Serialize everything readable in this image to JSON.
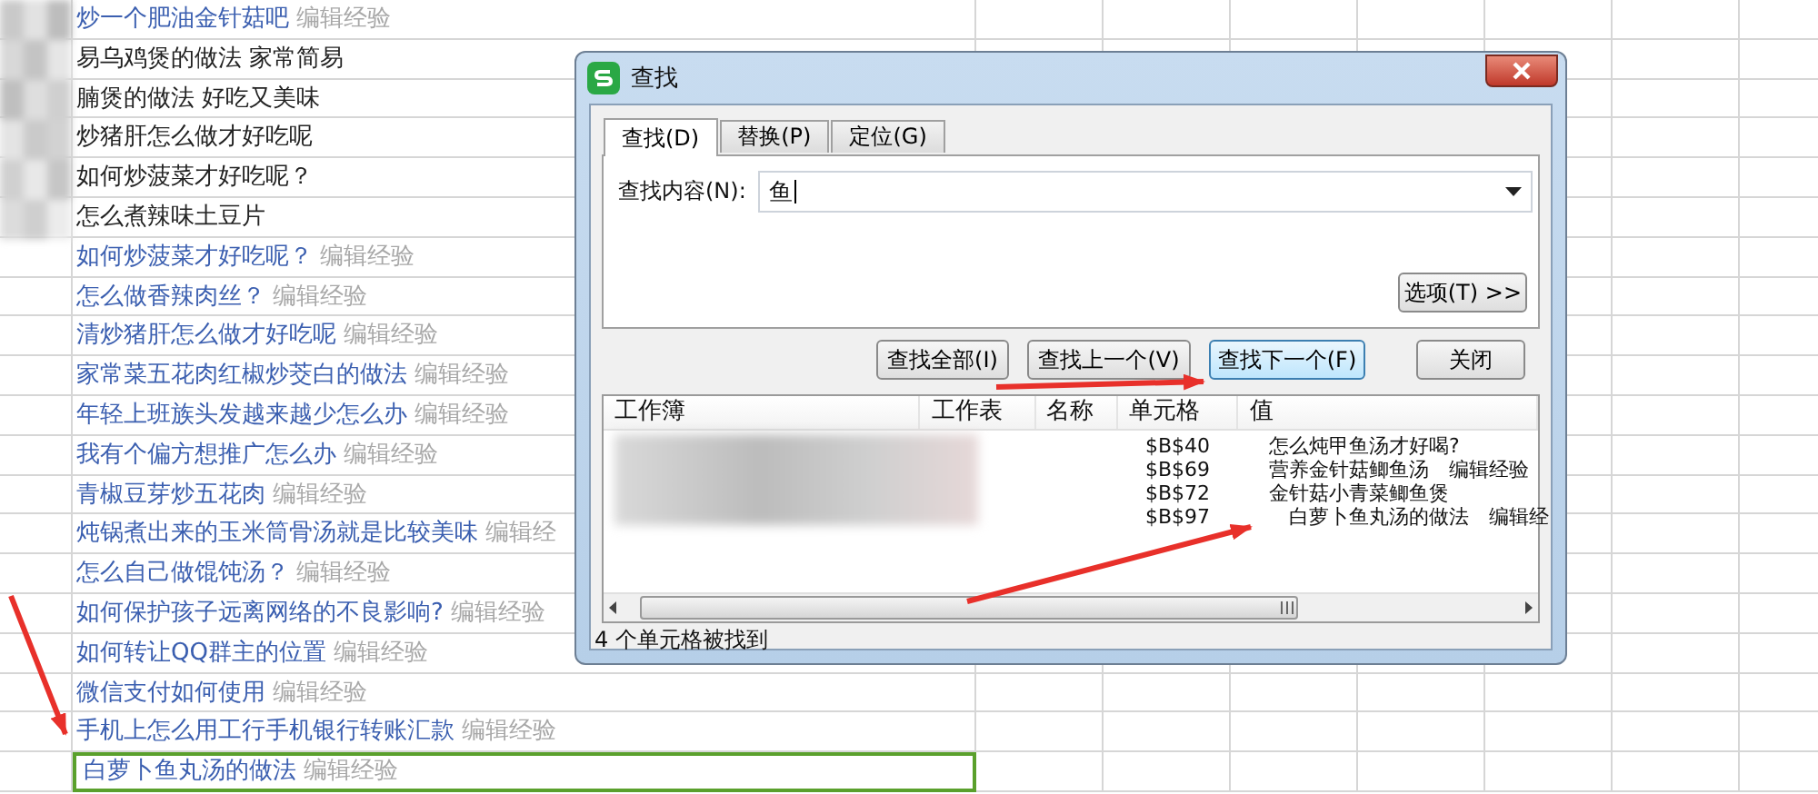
{
  "sheet": {
    "rows": [
      {
        "text": "炒一个肥油金针菇吧",
        "note": "编辑经验",
        "kind": "link",
        "selected": false
      },
      {
        "text": "易乌鸡煲的做法 家常简易",
        "kind": "plain",
        "selected": false
      },
      {
        "text": "腩煲的做法 好吃又美味",
        "kind": "plain",
        "selected": false
      },
      {
        "text": "炒猪肝怎么做才好吃呢",
        "kind": "plain",
        "selected": false
      },
      {
        "text": "如何炒菠菜才好吃呢？",
        "kind": "plain",
        "selected": false
      },
      {
        "text": "怎么煮辣味土豆片",
        "kind": "plain",
        "selected": false
      },
      {
        "text": "如何炒菠菜才好吃呢？",
        "note": "编辑经验",
        "kind": "link",
        "selected": false
      },
      {
        "text": "怎么做香辣肉丝？",
        "note": "编辑经验",
        "kind": "link",
        "selected": false
      },
      {
        "text": "清炒猪肝怎么做才好吃呢",
        "note": "编辑经验",
        "kind": "link",
        "selected": false
      },
      {
        "text": "家常菜五花肉红椒炒茭白的做法",
        "note": "编辑经验",
        "kind": "link",
        "selected": false
      },
      {
        "text": "年轻上班族头发越来越少怎么办",
        "note": "编辑经验",
        "kind": "link",
        "selected": false
      },
      {
        "text": "我有个偏方想推广怎么办",
        "note": "编辑经验",
        "kind": "link",
        "selected": false
      },
      {
        "text": "青椒豆芽炒五花肉",
        "note": "编辑经验",
        "kind": "link",
        "selected": false
      },
      {
        "text": "炖锅煮出来的玉米筒骨汤就是比较美味",
        "note": "编辑经",
        "kind": "link",
        "selected": false
      },
      {
        "text": "怎么自己做馄饨汤？",
        "note": "编辑经验",
        "kind": "link",
        "selected": false
      },
      {
        "text": "如何保护孩子远离网络的不良影响?",
        "note": "编辑经验",
        "kind": "link",
        "selected": false
      },
      {
        "text": "如何转让QQ群主的位置",
        "note": "编辑经验",
        "kind": "link",
        "selected": false
      },
      {
        "text": "微信支付如何使用",
        "note": "编辑经验",
        "kind": "link",
        "selected": false
      },
      {
        "text": "手机上怎么用工行手机银行转账汇款",
        "note": "编辑经验",
        "kind": "link",
        "selected": false
      },
      {
        "text": "白萝卜鱼丸汤的做法",
        "note": "编辑经验",
        "kind": "link",
        "selected": true
      }
    ]
  },
  "dialog": {
    "title": "查找",
    "tabs": [
      {
        "label": "查找(D)",
        "selected": true
      },
      {
        "label": "替换(P)",
        "selected": false
      },
      {
        "label": "定位(G)",
        "selected": false
      }
    ],
    "find_label": "查找内容(N):",
    "find_value": "鱼",
    "options_button": "选项(T) >>",
    "buttons": [
      {
        "label": "查找全部(I)",
        "selected": false
      },
      {
        "label": "查找上一个(V)",
        "selected": false
      },
      {
        "label": "查找下一个(F)",
        "selected": true
      },
      {
        "label": "关闭",
        "selected": false
      }
    ],
    "results": {
      "columns": [
        "工作簿",
        "工作表",
        "名称",
        "单元格",
        "值"
      ],
      "rows": [
        {
          "cell": "$B$40",
          "value": "怎么炖甲鱼汤才好喝?"
        },
        {
          "cell": "$B$69",
          "value": "营养金针菇鲫鱼汤　编辑经验"
        },
        {
          "cell": "$B$72",
          "value": "金针菇小青菜鲫鱼煲"
        },
        {
          "cell": "$B$97",
          "value": "　白萝卜鱼丸汤的做法　编辑经"
        }
      ]
    },
    "status": "4 个单元格被找到"
  }
}
